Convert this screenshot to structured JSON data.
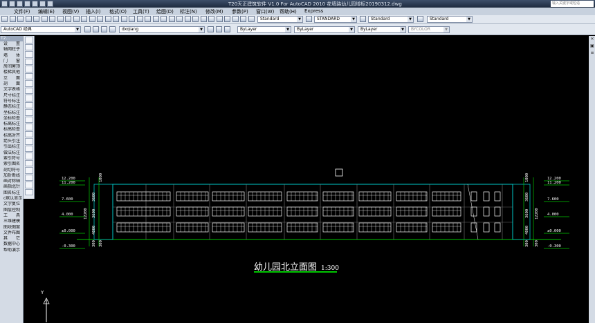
{
  "titlebar": {
    "title": "T20天正建筑软件 V1.0 For AutoCAD 2010    花墙路幼儿园增标20190312.dwg",
    "help_placeholder": "输入关键字或短语"
  },
  "menu": [
    "文件(F)",
    "编辑(E)",
    "视图(V)",
    "插入(I)",
    "格式(O)",
    "工具(T)",
    "绘图(D)",
    "标注(N)",
    "修改(M)",
    "参数(P)",
    "窗口(W)",
    "帮助(H)",
    "Express"
  ],
  "toolbar": {
    "text_style": "Standard",
    "dim_style": "STANDARD",
    "table_style": "Standard",
    "mleader_style": "Standard",
    "workspace": "AutoCAD 经典",
    "layer": "dxqiang",
    "color": "ByLayer",
    "linetype": "ByLayer",
    "lineweight": "ByLayer",
    "plotstyle": "BYCOLOR"
  },
  "palette": {
    "header": "T2...",
    "items": [
      "设　　置",
      "轴网柱子",
      "墙　　体",
      "门　　窗",
      "房间屋顶",
      "楼梯其他",
      "立　　面",
      "剖　　面",
      "文字表格",
      "尺寸标注",
      "符号标注",
      "图层控制",
      "工　　具",
      "三维建模",
      "图块图案",
      "文件布图",
      "其　　它",
      "数据中心",
      "帮助演示"
    ],
    "items2": [
      "静态标注",
      "坐标标注",
      "坐标检查",
      "标高标注",
      "标高检查",
      "标高对齐",
      "箭头引注",
      "引出标注",
      "做法标注",
      "索引符号",
      "索引图名",
      "剖切符号",
      "加折断线",
      "画对称轴",
      "画指北针",
      "图名标注",
      "c默认显示",
      "文字复位"
    ]
  },
  "drawing": {
    "title": "幼儿园北立面图",
    "scale": "1:300",
    "elev_left": [
      "12.200",
      "11.200",
      "7.600",
      "4.000",
      "±0.000",
      "-0.300"
    ],
    "elev_right": [
      "12.200",
      "11.200",
      "7.600",
      "4.000",
      "±0.000",
      "-0.300"
    ],
    "dims_left": [
      "1000",
      "3600",
      "3600",
      "4000",
      "300",
      "300",
      "12200"
    ],
    "dims_right": [
      "1000",
      "3600",
      "3600",
      "4000",
      "300",
      "300",
      "12200"
    ],
    "ucs_label": "Y"
  },
  "colors": {
    "background": "#000000",
    "building": "#00c8c8",
    "dim_green": "#00c800",
    "text": "#ffffff"
  }
}
